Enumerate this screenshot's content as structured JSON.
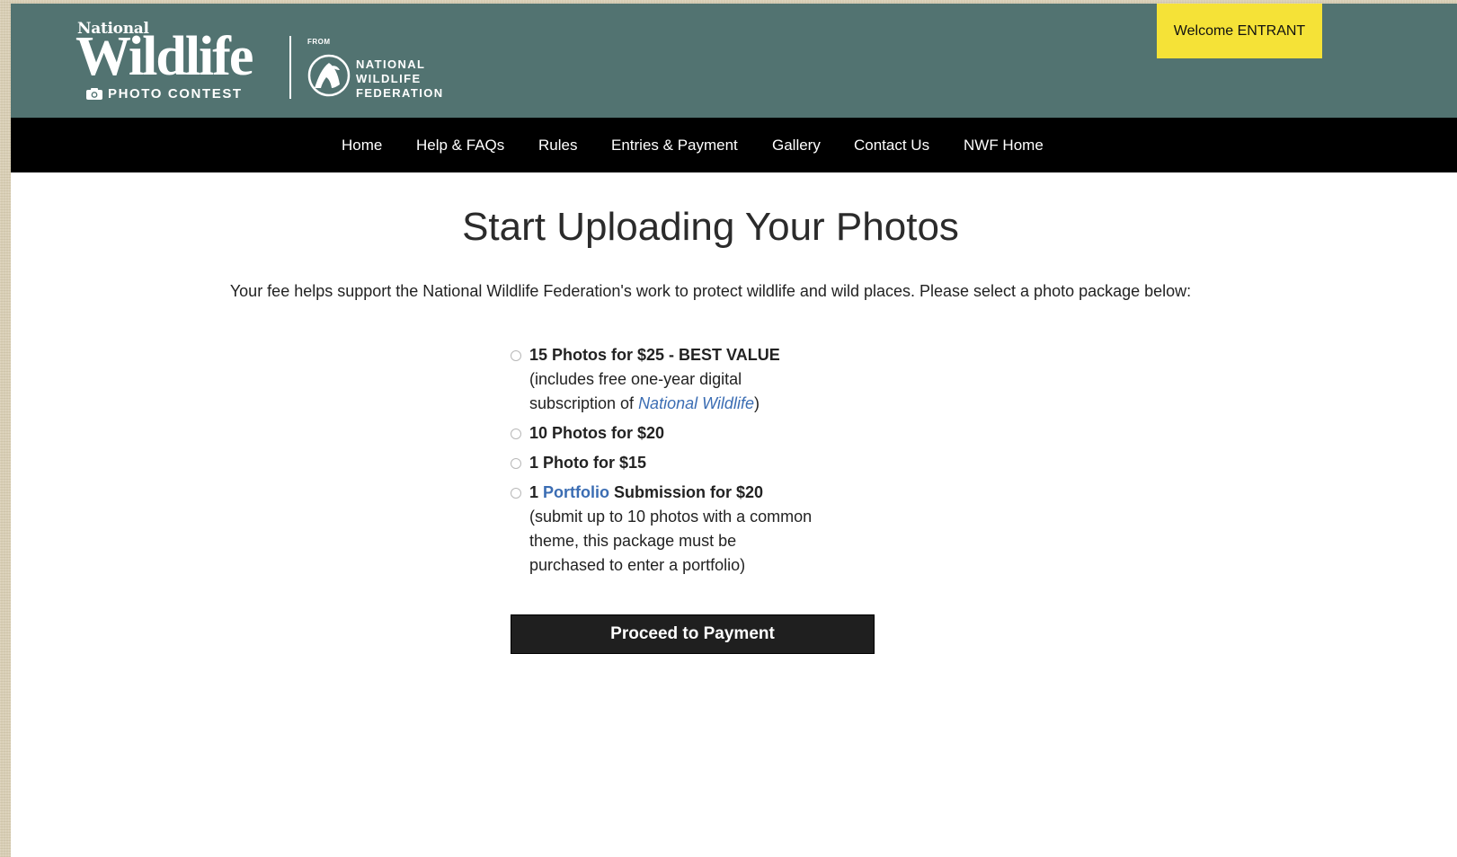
{
  "header": {
    "logo": {
      "national": "National",
      "wildlife": "Wildlife",
      "contest": "PHOTO CONTEST",
      "from": "FROM",
      "nwf_line1": "NATIONAL",
      "nwf_line2": "WILDLIFE",
      "nwf_line3": "FEDERATION"
    },
    "welcome": "Welcome ENTRANT",
    "colors": {
      "header_bg": "#527371",
      "welcome_bg": "#f5e237",
      "nav_bg": "#000000"
    }
  },
  "nav": {
    "items": [
      {
        "label": "Home"
      },
      {
        "label": "Help & FAQs"
      },
      {
        "label": "Rules"
      },
      {
        "label": "Entries & Payment"
      },
      {
        "label": "Gallery"
      },
      {
        "label": "Contact Us"
      },
      {
        "label": "NWF Home"
      }
    ]
  },
  "main": {
    "title": "Start Uploading Your Photos",
    "intro": "Your fee helps support the National Wildlife Federation's work to protect wildlife and wild places. Please select a photo package below:",
    "packages": [
      {
        "title": "15 Photos for $25 - BEST VALUE",
        "desc_before": "(includes free one-year digital subscription of ",
        "desc_link": "National Wildlife",
        "desc_after": ")",
        "selected": false
      },
      {
        "title": "10 Photos for $20",
        "selected": false
      },
      {
        "title": "1 Photo for $15",
        "selected": false
      },
      {
        "title_prefix": "1 ",
        "title_link": "Portfolio",
        "title_suffix": " Submission for $20",
        "desc": "(submit up to 10 photos with a common theme, this package must be purchased to enter a portfolio)",
        "selected": false
      }
    ],
    "proceed_label": "Proceed to Payment",
    "link_color": "#3b6db3"
  }
}
